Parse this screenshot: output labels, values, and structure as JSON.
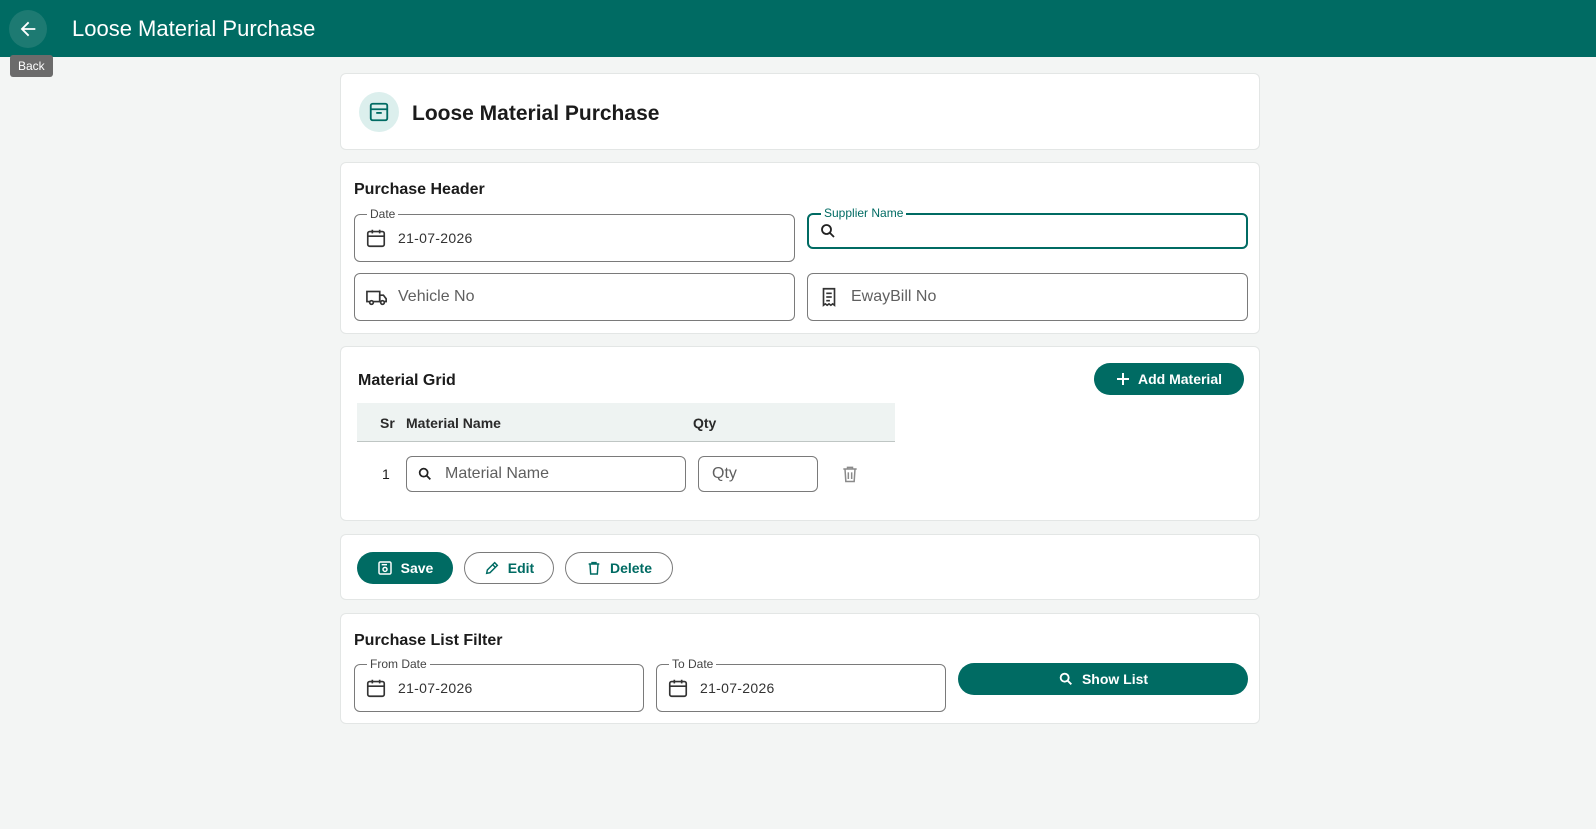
{
  "appbar": {
    "title": "Loose Material Purchase",
    "back_tooltip": "Back",
    "back_icon": "arrow-back-icon"
  },
  "page": {
    "heading": "Loose Material Purchase",
    "heading_icon": "archive-box-icon"
  },
  "purchase_header": {
    "title": "Purchase Header",
    "date_label": "Date",
    "date_value": "21-07-2026",
    "supplier_label": "Supplier Name",
    "supplier_value": "",
    "vehicle_placeholder": "Vehicle No",
    "eway_placeholder": "EwayBill No"
  },
  "material_grid": {
    "title": "Material Grid",
    "add_label": "Add Material",
    "columns": [
      "Sr",
      "Material Name",
      "Qty"
    ],
    "rows": [
      {
        "sr": "1",
        "material_placeholder": "Material Name",
        "qty_placeholder": "Qty"
      }
    ]
  },
  "actions": {
    "save": "Save",
    "edit": "Edit",
    "delete": "Delete"
  },
  "filter": {
    "title": "Purchase List Filter",
    "from_label": "From Date",
    "from_value": "21-07-2026",
    "to_label": "To Date",
    "to_value": "21-07-2026",
    "show_list": "Show List"
  },
  "colors": {
    "primary": "#006b63",
    "background": "#f3f5f4"
  }
}
